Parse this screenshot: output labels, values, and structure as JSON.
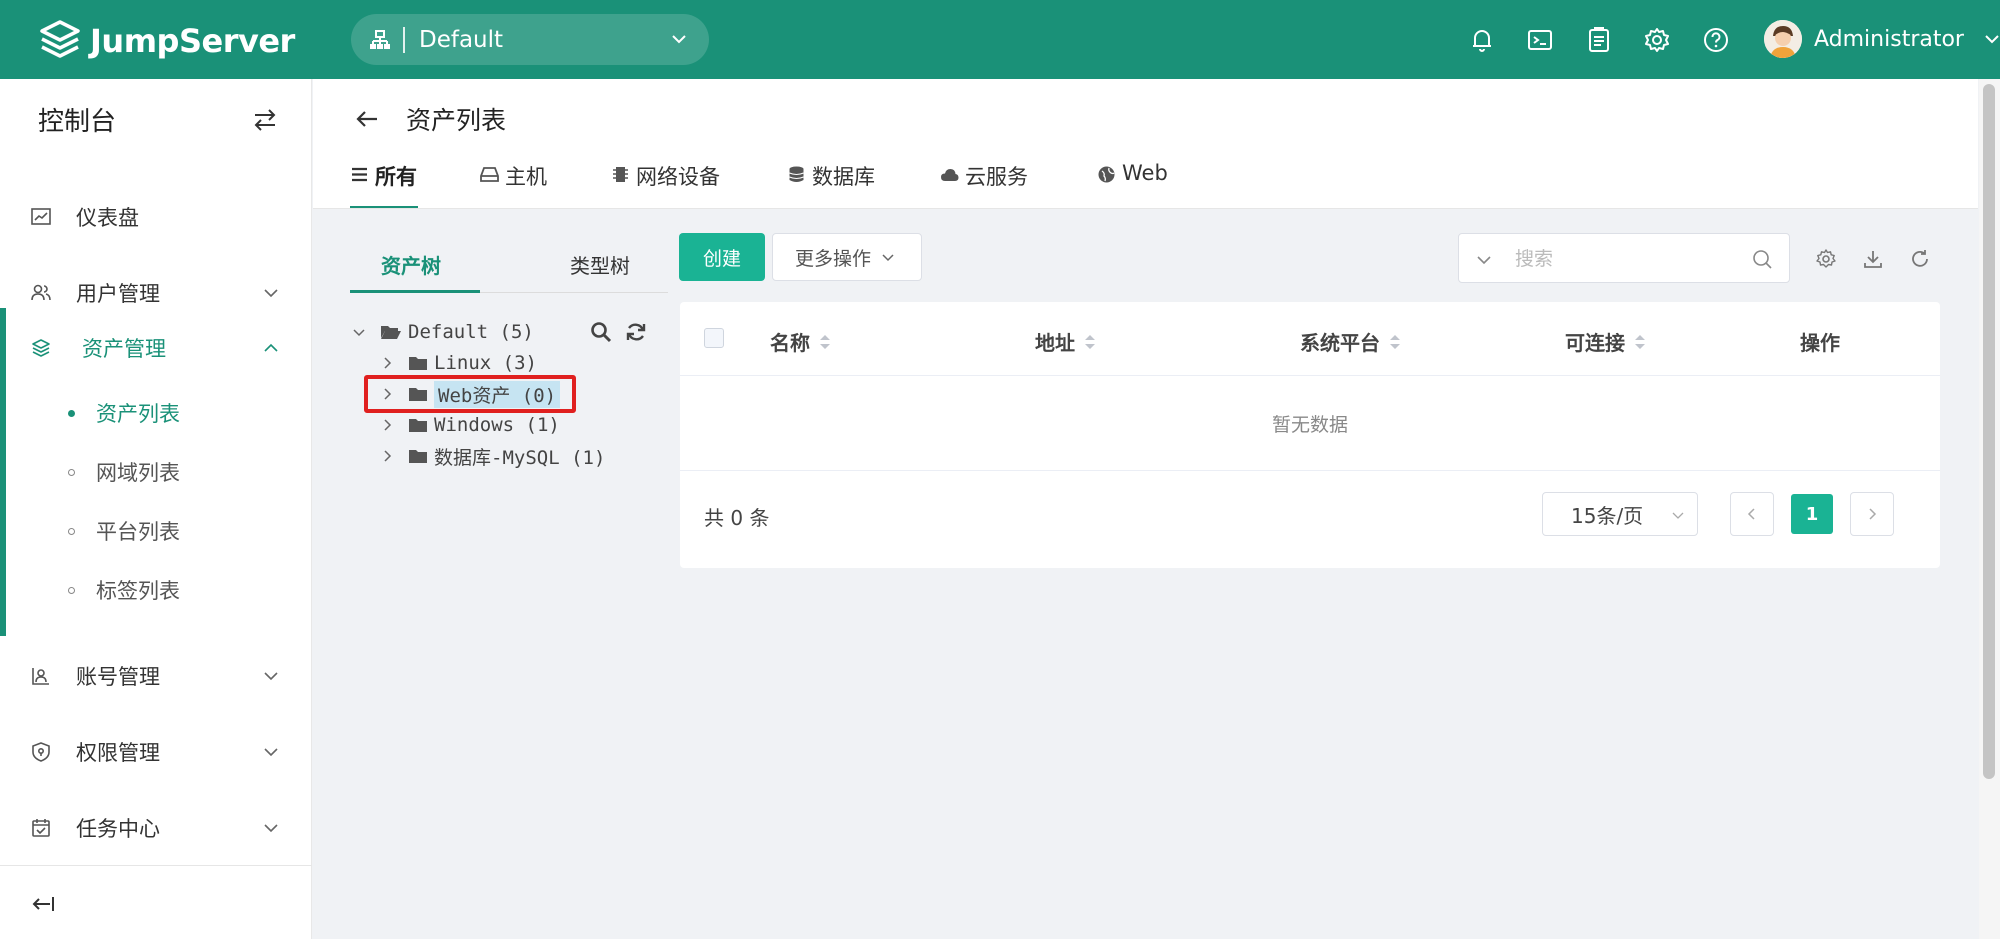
{
  "header": {
    "logo_text": "JumpServer",
    "org_name": "Default",
    "user_name": "Administrator"
  },
  "sidebar": {
    "title": "控制台",
    "items": [
      {
        "label": "仪表盘",
        "icon": "dashboard-icon"
      },
      {
        "label": "用户管理",
        "icon": "users-icon"
      },
      {
        "label": "资产管理",
        "icon": "assets-icon"
      },
      {
        "label": "账号管理",
        "icon": "accounts-icon"
      },
      {
        "label": "权限管理",
        "icon": "permissions-icon"
      },
      {
        "label": "任务中心",
        "icon": "tasks-icon"
      }
    ],
    "subitems": [
      "资产列表",
      "网域列表",
      "平台列表",
      "标签列表"
    ]
  },
  "page": {
    "title": "资产列表",
    "tabs": [
      "所有",
      "主机",
      "网络设备",
      "数据库",
      "云服务",
      "Web"
    ]
  },
  "tree": {
    "tabs": [
      "资产树",
      "类型树"
    ],
    "root": "Default (5)",
    "children": [
      "Linux (3)",
      "Web资产 (0)",
      "Windows (1)",
      "数据库-MySQL (1)"
    ]
  },
  "toolbar": {
    "create_label": "创建",
    "more_label": "更多操作",
    "search_placeholder": "搜索"
  },
  "table": {
    "columns": [
      "名称",
      "地址",
      "系统平台",
      "可连接",
      "操作"
    ],
    "empty_text": "暂无数据"
  },
  "pagination": {
    "total_text": "共 0 条",
    "page_size": "15条/页",
    "current_page": "1"
  },
  "colors": {
    "brand": "#1a9178",
    "button": "#1ab394",
    "highlight": "#e0201f"
  }
}
